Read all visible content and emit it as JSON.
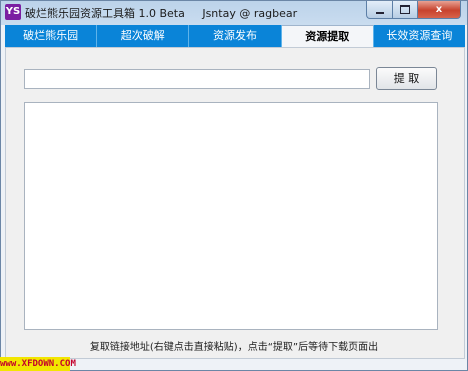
{
  "window": {
    "icon_text": "YS",
    "title": "破烂熊乐园资源工具箱 1.0 Beta     Jsntay @ ragbear"
  },
  "caption": {
    "close_symbol": "x"
  },
  "tabs": [
    {
      "label": "破烂熊乐园",
      "active": false
    },
    {
      "label": "超次破解",
      "active": false
    },
    {
      "label": "资源发布",
      "active": false
    },
    {
      "label": "资源提取",
      "active": true
    },
    {
      "label": "长效资源查询",
      "active": false
    }
  ],
  "extract": {
    "url_value": "",
    "button_label": "提 取",
    "output_text": "",
    "hint": "复取链接地址(右键点击直接粘贴)，点击“提取”后等待下载页面出"
  },
  "watermark": "www.XFDOWN.COM"
}
